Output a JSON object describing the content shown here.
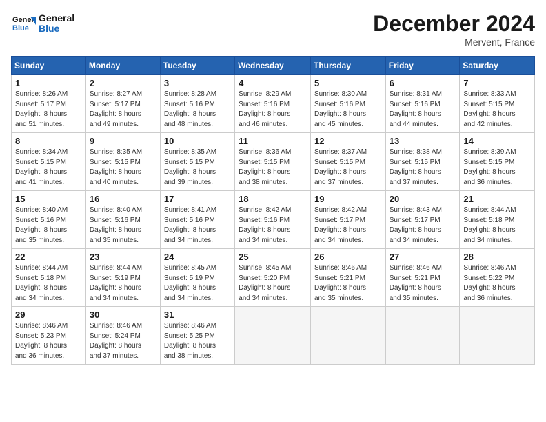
{
  "header": {
    "logo_line1": "General",
    "logo_line2": "Blue",
    "month": "December 2024",
    "location": "Mervent, France"
  },
  "weekdays": [
    "Sunday",
    "Monday",
    "Tuesday",
    "Wednesday",
    "Thursday",
    "Friday",
    "Saturday"
  ],
  "weeks": [
    [
      {
        "day": "1",
        "detail": "Sunrise: 8:26 AM\nSunset: 5:17 PM\nDaylight: 8 hours\nand 51 minutes."
      },
      {
        "day": "2",
        "detail": "Sunrise: 8:27 AM\nSunset: 5:17 PM\nDaylight: 8 hours\nand 49 minutes."
      },
      {
        "day": "3",
        "detail": "Sunrise: 8:28 AM\nSunset: 5:16 PM\nDaylight: 8 hours\nand 48 minutes."
      },
      {
        "day": "4",
        "detail": "Sunrise: 8:29 AM\nSunset: 5:16 PM\nDaylight: 8 hours\nand 46 minutes."
      },
      {
        "day": "5",
        "detail": "Sunrise: 8:30 AM\nSunset: 5:16 PM\nDaylight: 8 hours\nand 45 minutes."
      },
      {
        "day": "6",
        "detail": "Sunrise: 8:31 AM\nSunset: 5:16 PM\nDaylight: 8 hours\nand 44 minutes."
      },
      {
        "day": "7",
        "detail": "Sunrise: 8:33 AM\nSunset: 5:15 PM\nDaylight: 8 hours\nand 42 minutes."
      }
    ],
    [
      {
        "day": "8",
        "detail": "Sunrise: 8:34 AM\nSunset: 5:15 PM\nDaylight: 8 hours\nand 41 minutes."
      },
      {
        "day": "9",
        "detail": "Sunrise: 8:35 AM\nSunset: 5:15 PM\nDaylight: 8 hours\nand 40 minutes."
      },
      {
        "day": "10",
        "detail": "Sunrise: 8:35 AM\nSunset: 5:15 PM\nDaylight: 8 hours\nand 39 minutes."
      },
      {
        "day": "11",
        "detail": "Sunrise: 8:36 AM\nSunset: 5:15 PM\nDaylight: 8 hours\nand 38 minutes."
      },
      {
        "day": "12",
        "detail": "Sunrise: 8:37 AM\nSunset: 5:15 PM\nDaylight: 8 hours\nand 37 minutes."
      },
      {
        "day": "13",
        "detail": "Sunrise: 8:38 AM\nSunset: 5:15 PM\nDaylight: 8 hours\nand 37 minutes."
      },
      {
        "day": "14",
        "detail": "Sunrise: 8:39 AM\nSunset: 5:15 PM\nDaylight: 8 hours\nand 36 minutes."
      }
    ],
    [
      {
        "day": "15",
        "detail": "Sunrise: 8:40 AM\nSunset: 5:16 PM\nDaylight: 8 hours\nand 35 minutes."
      },
      {
        "day": "16",
        "detail": "Sunrise: 8:40 AM\nSunset: 5:16 PM\nDaylight: 8 hours\nand 35 minutes."
      },
      {
        "day": "17",
        "detail": "Sunrise: 8:41 AM\nSunset: 5:16 PM\nDaylight: 8 hours\nand 34 minutes."
      },
      {
        "day": "18",
        "detail": "Sunrise: 8:42 AM\nSunset: 5:16 PM\nDaylight: 8 hours\nand 34 minutes."
      },
      {
        "day": "19",
        "detail": "Sunrise: 8:42 AM\nSunset: 5:17 PM\nDaylight: 8 hours\nand 34 minutes."
      },
      {
        "day": "20",
        "detail": "Sunrise: 8:43 AM\nSunset: 5:17 PM\nDaylight: 8 hours\nand 34 minutes."
      },
      {
        "day": "21",
        "detail": "Sunrise: 8:44 AM\nSunset: 5:18 PM\nDaylight: 8 hours\nand 34 minutes."
      }
    ],
    [
      {
        "day": "22",
        "detail": "Sunrise: 8:44 AM\nSunset: 5:18 PM\nDaylight: 8 hours\nand 34 minutes."
      },
      {
        "day": "23",
        "detail": "Sunrise: 8:44 AM\nSunset: 5:19 PM\nDaylight: 8 hours\nand 34 minutes."
      },
      {
        "day": "24",
        "detail": "Sunrise: 8:45 AM\nSunset: 5:19 PM\nDaylight: 8 hours\nand 34 minutes."
      },
      {
        "day": "25",
        "detail": "Sunrise: 8:45 AM\nSunset: 5:20 PM\nDaylight: 8 hours\nand 34 minutes."
      },
      {
        "day": "26",
        "detail": "Sunrise: 8:46 AM\nSunset: 5:21 PM\nDaylight: 8 hours\nand 35 minutes."
      },
      {
        "day": "27",
        "detail": "Sunrise: 8:46 AM\nSunset: 5:21 PM\nDaylight: 8 hours\nand 35 minutes."
      },
      {
        "day": "28",
        "detail": "Sunrise: 8:46 AM\nSunset: 5:22 PM\nDaylight: 8 hours\nand 36 minutes."
      }
    ],
    [
      {
        "day": "29",
        "detail": "Sunrise: 8:46 AM\nSunset: 5:23 PM\nDaylight: 8 hours\nand 36 minutes."
      },
      {
        "day": "30",
        "detail": "Sunrise: 8:46 AM\nSunset: 5:24 PM\nDaylight: 8 hours\nand 37 minutes."
      },
      {
        "day": "31",
        "detail": "Sunrise: 8:46 AM\nSunset: 5:25 PM\nDaylight: 8 hours\nand 38 minutes."
      },
      null,
      null,
      null,
      null
    ]
  ]
}
